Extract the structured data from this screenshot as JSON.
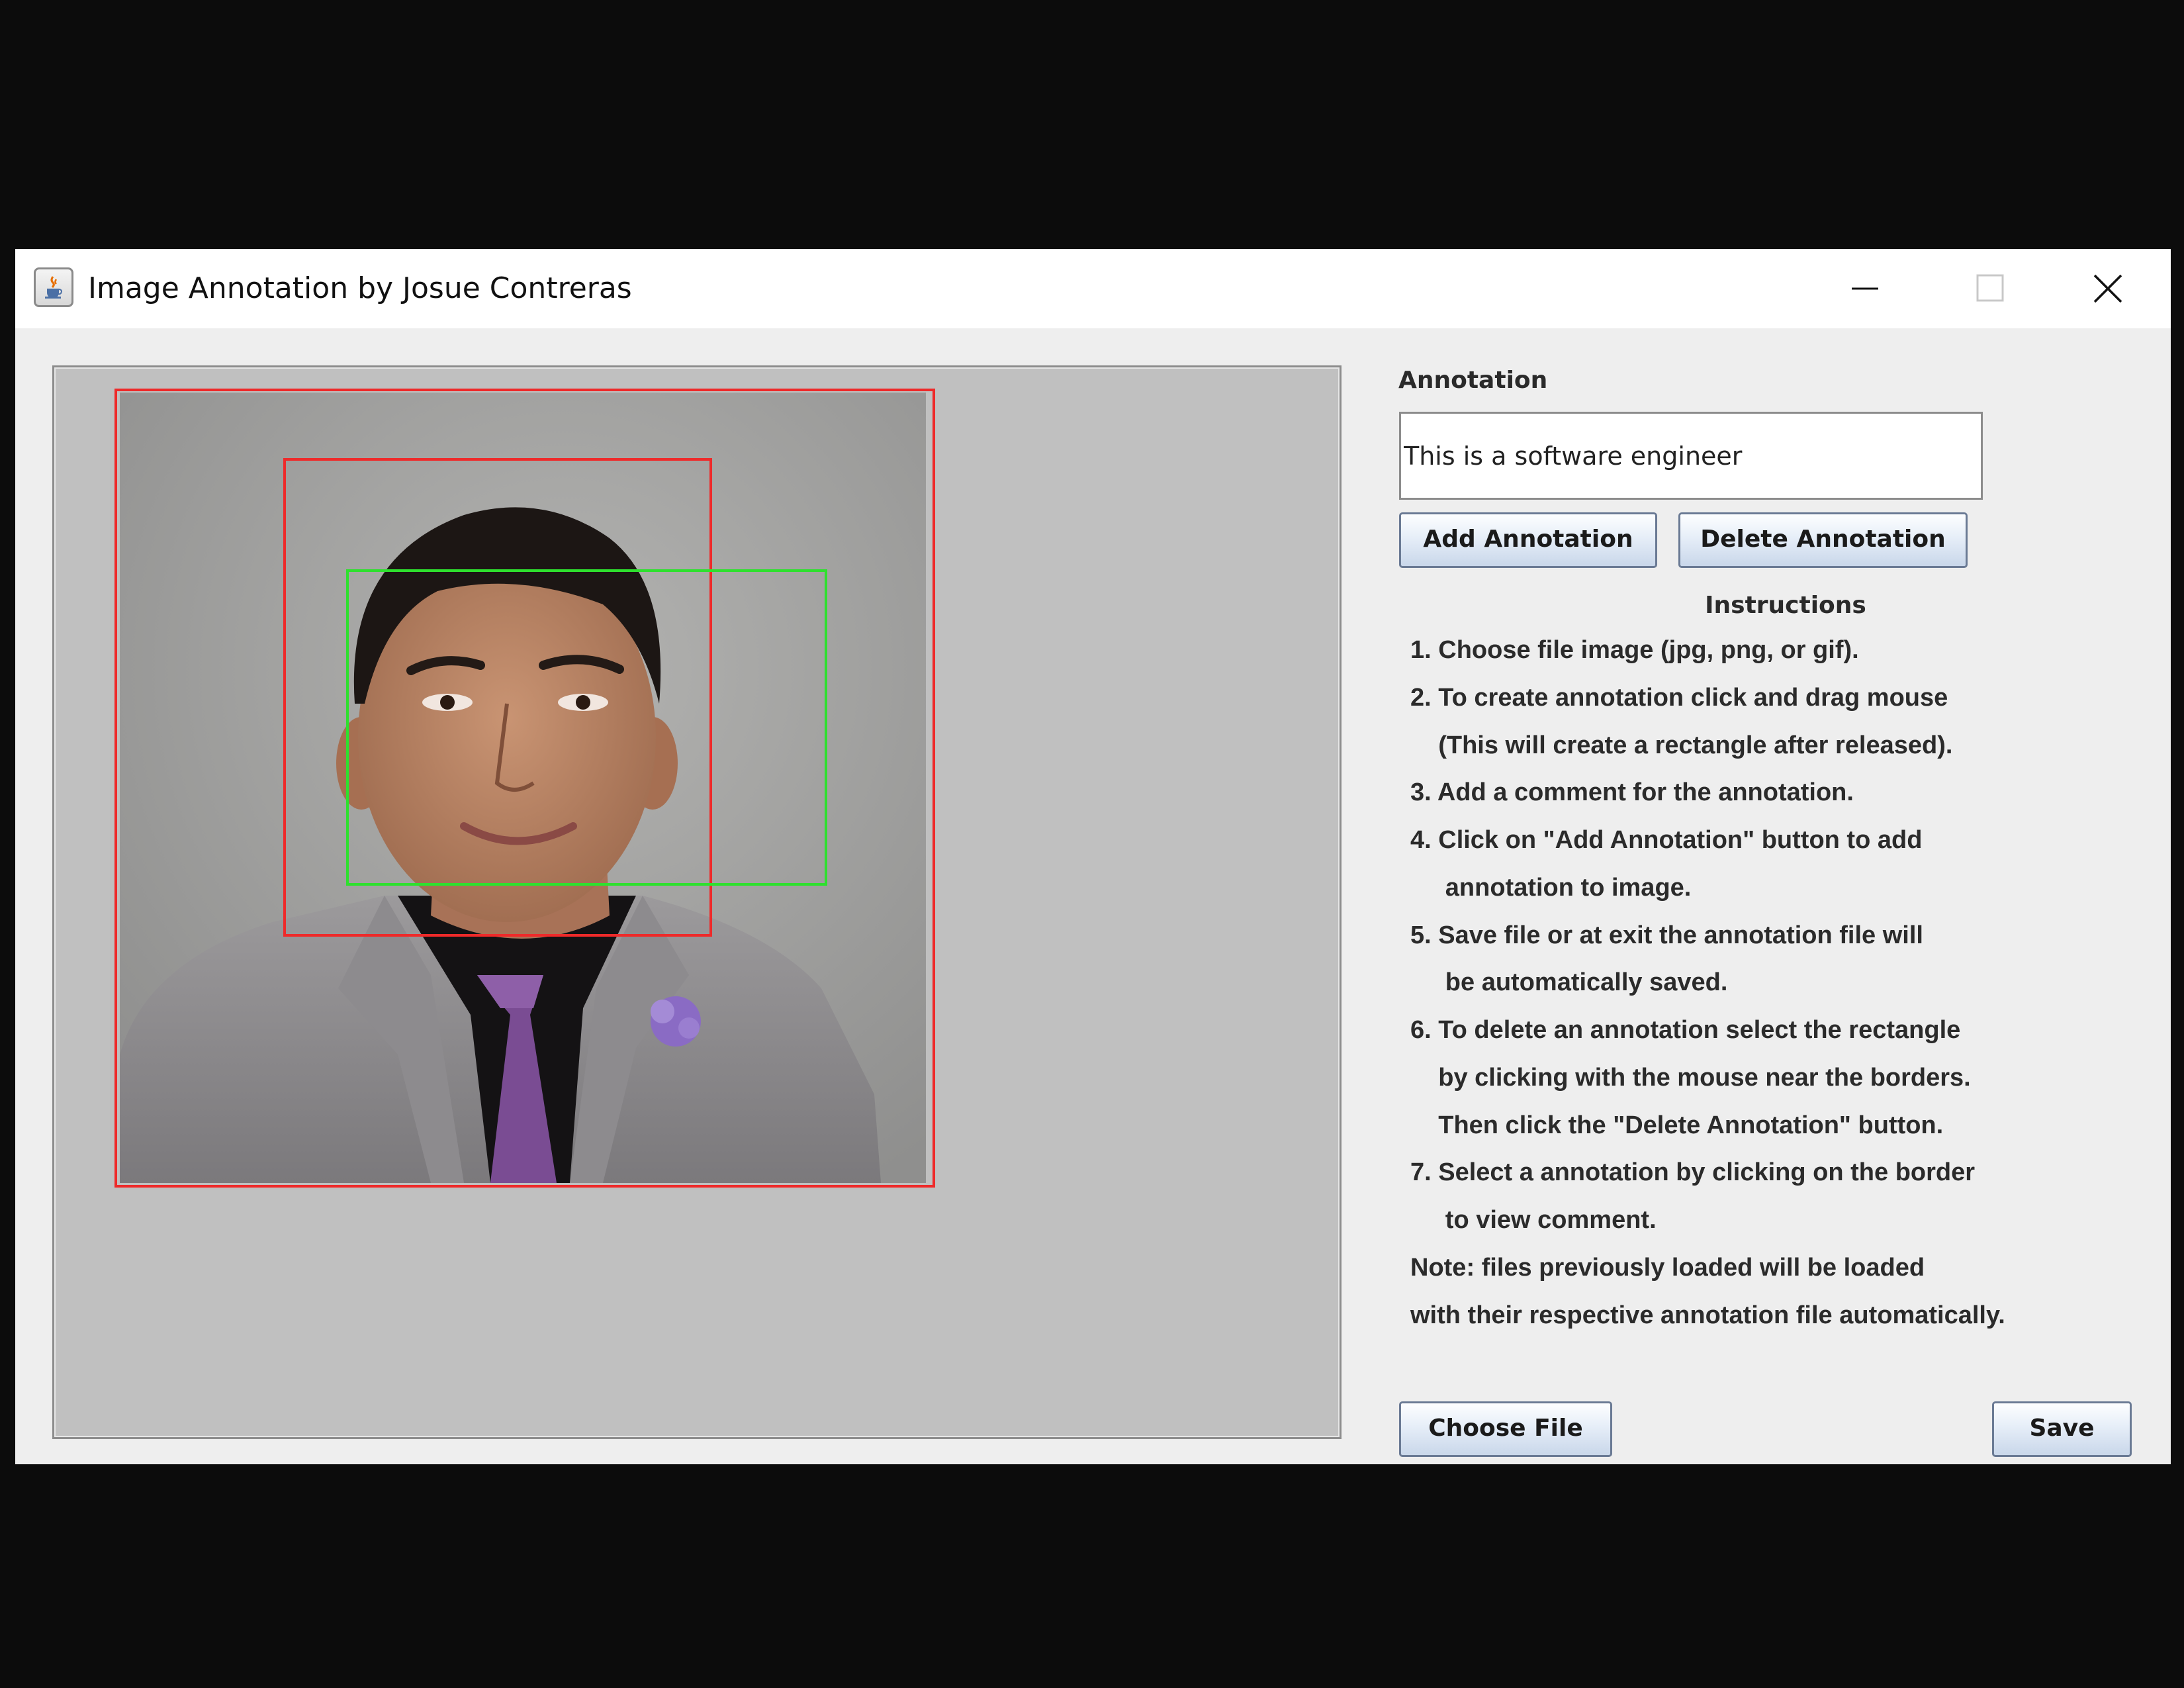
{
  "window": {
    "title": "Image Annotation by Josue Contreras",
    "icon": "java-cup-icon"
  },
  "annotation": {
    "label": "Annotation",
    "value": "This is a software engineer"
  },
  "buttons": {
    "add": "Add Annotation",
    "delete": "Delete Annotation",
    "choose_file": "Choose File",
    "save": "Save"
  },
  "instructions": {
    "title": "Instructions",
    "lines": [
      "1. Choose file image (jpg, png, or gif).",
      "2. To create annotation click and drag mouse",
      "    (This will create a rectangle after released).",
      "3. Add a comment for the annotation.",
      "4. Click on \"Add Annotation\" button to add",
      "     annotation to image.",
      "5. Save file or at exit the annotation file will",
      "     be automatically saved.",
      "6. To delete an annotation select the rectangle",
      "    by clicking with the mouse near the borders.",
      "    Then click the \"Delete Annotation\" button.",
      "7. Select a annotation by clicking on the border",
      "     to view comment.",
      "Note: files previously loaded will be loaded",
      "with their respective annotation file automatically."
    ]
  },
  "colors": {
    "annotation_rect": "#ee2a2a",
    "selected_rect": "#2ee02e",
    "canvas_bg": "#c0c0c0"
  }
}
